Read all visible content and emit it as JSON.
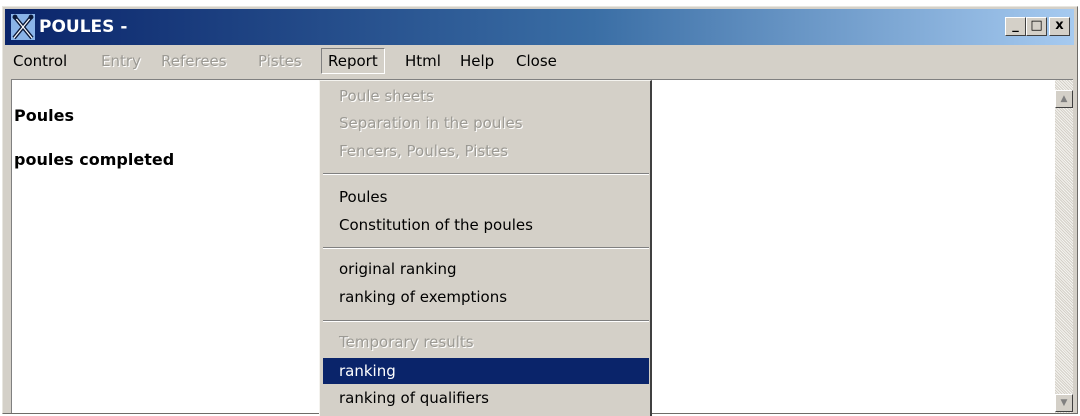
{
  "window": {
    "title": "POULES -",
    "app_icon": "fencing-x-icon",
    "titlebar_gradient": [
      "#0a246a",
      "#3a6ea5",
      "#a6caf0"
    ],
    "controls": {
      "minimize_glyph": "_",
      "maximize_glyph": "□",
      "close_glyph": "x"
    }
  },
  "menubar": {
    "items": [
      {
        "label": "Control",
        "enabled": true
      },
      {
        "label": "Entry",
        "enabled": false
      },
      {
        "label": "Referees",
        "enabled": false
      },
      {
        "label": "Pistes",
        "enabled": false
      },
      {
        "label": "Report",
        "enabled": true,
        "open": true
      },
      {
        "label": "Html",
        "enabled": true
      },
      {
        "label": "Help",
        "enabled": true
      },
      {
        "label": "Close",
        "enabled": true
      }
    ]
  },
  "content": {
    "lines": [
      "Poules",
      "poules completed"
    ]
  },
  "report_menu": {
    "items": [
      {
        "label": "Poule sheets",
        "enabled": false
      },
      {
        "label": "Separation in the poules",
        "enabled": false
      },
      {
        "label": "Fencers, Poules, Pistes",
        "enabled": false
      },
      {
        "label": "Poules",
        "enabled": true
      },
      {
        "label": "Constitution of the poules",
        "enabled": true
      },
      {
        "label": "original ranking",
        "enabled": true
      },
      {
        "label": "ranking of exemptions",
        "enabled": true
      },
      {
        "label": "Temporary results",
        "enabled": false
      },
      {
        "label": "ranking",
        "enabled": true,
        "selected": true
      },
      {
        "label": "ranking of qualifiers",
        "enabled": true
      }
    ]
  },
  "colors": {
    "face": "#d4d0c8",
    "highlight": "#0a246a",
    "disabled_text": "#9c9a94"
  }
}
